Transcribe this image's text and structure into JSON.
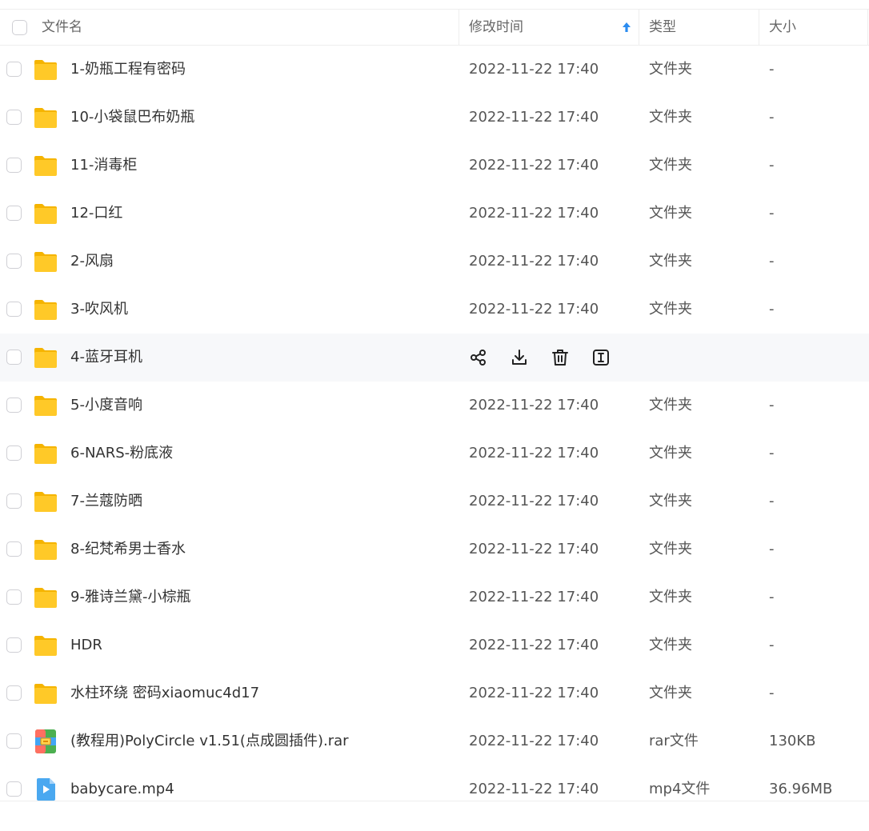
{
  "header": {
    "name_label": "文件名",
    "modified_label": "修改时间",
    "type_label": "类型",
    "size_label": "大小",
    "sort_icon": "sort-ascending-arrow-icon",
    "accent_color": "#2b8cf0"
  },
  "rows": [
    {
      "name": "1-奶瓶工程有密码",
      "modified": "2022-11-22 17:40",
      "type": "文件夹",
      "size": "-",
      "icon": "folder-icon"
    },
    {
      "name": "10-小袋鼠巴布奶瓶",
      "modified": "2022-11-22 17:40",
      "type": "文件夹",
      "size": "-",
      "icon": "folder-icon"
    },
    {
      "name": "11-消毒柜",
      "modified": "2022-11-22 17:40",
      "type": "文件夹",
      "size": "-",
      "icon": "folder-icon"
    },
    {
      "name": "12-口红",
      "modified": "2022-11-22 17:40",
      "type": "文件夹",
      "size": "-",
      "icon": "folder-icon"
    },
    {
      "name": "2-风扇",
      "modified": "2022-11-22 17:40",
      "type": "文件夹",
      "size": "-",
      "icon": "folder-icon"
    },
    {
      "name": "3-吹风机",
      "modified": "2022-11-22 17:40",
      "type": "文件夹",
      "size": "-",
      "icon": "folder-icon"
    },
    {
      "name": "4-蓝牙耳机",
      "modified": "",
      "type": "",
      "size": "",
      "icon": "folder-icon",
      "hovered": true,
      "actions": [
        "share-icon",
        "download-icon",
        "delete-icon",
        "rename-icon"
      ]
    },
    {
      "name": "5-小度音响",
      "modified": "2022-11-22 17:40",
      "type": "文件夹",
      "size": "-",
      "icon": "folder-icon"
    },
    {
      "name": "6-NARS-粉底液",
      "modified": "2022-11-22 17:40",
      "type": "文件夹",
      "size": "-",
      "icon": "folder-icon"
    },
    {
      "name": "7-兰蔻防晒",
      "modified": "2022-11-22 17:40",
      "type": "文件夹",
      "size": "-",
      "icon": "folder-icon"
    },
    {
      "name": "8-纪梵希男士香水",
      "modified": "2022-11-22 17:40",
      "type": "文件夹",
      "size": "-",
      "icon": "folder-icon"
    },
    {
      "name": "9-雅诗兰黛-小棕瓶",
      "modified": "2022-11-22 17:40",
      "type": "文件夹",
      "size": "-",
      "icon": "folder-icon"
    },
    {
      "name": "HDR",
      "modified": "2022-11-22 17:40",
      "type": "文件夹",
      "size": "-",
      "icon": "folder-icon"
    },
    {
      "name": "水柱环绕 密码xiaomuc4d17",
      "modified": "2022-11-22 17:40",
      "type": "文件夹",
      "size": "-",
      "icon": "folder-icon"
    },
    {
      "name": "(教程用)PolyCircle v1.51(点成圆插件).rar",
      "modified": "2022-11-22 17:40",
      "type": "rar文件",
      "size": "130KB",
      "icon": "rar-file-icon"
    },
    {
      "name": "babycare.mp4",
      "modified": "2022-11-22 17:40",
      "type": "mp4文件",
      "size": "36.96MB",
      "icon": "video-file-icon"
    }
  ]
}
